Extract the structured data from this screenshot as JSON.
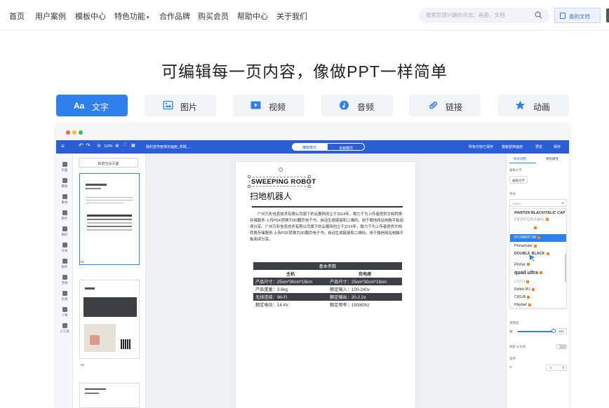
{
  "nav": {
    "items": [
      "首页",
      "用户案例",
      "模板中心",
      "特色功能",
      "合作品牌",
      "购买会员",
      "帮助中心",
      "关于我们"
    ],
    "search_placeholder": "搜索您感兴趣的杂志、画册、文档",
    "my_docs": "我的文档"
  },
  "hero": {
    "title": "可编辑每一页内容，像做PPT一样简单"
  },
  "feature_tabs": [
    {
      "label": "文字",
      "icon": "text-aa-icon",
      "active": true,
      "prefix": "Aa"
    },
    {
      "label": "图片",
      "icon": "image-icon",
      "active": false
    },
    {
      "label": "视频",
      "icon": "video-icon",
      "active": false
    },
    {
      "label": "音频",
      "icon": "audio-icon",
      "active": false
    },
    {
      "label": "链接",
      "icon": "link-icon",
      "active": false
    },
    {
      "label": "动画",
      "icon": "star-icon",
      "active": false
    }
  ],
  "editor": {
    "zoom": "116%",
    "doc_name": "我的宣传册演示画册_草稿_...",
    "mode_edit": "编辑模式",
    "mode_preview": "全貌模式",
    "save_status": "所有内容已保存",
    "top_actions": [
      "模板替换画册",
      "预览",
      "保存"
    ],
    "rail": [
      "页面",
      "模板",
      "素材",
      "图片",
      "图形",
      "文本",
      "组件",
      "音频",
      "云盘",
      "人物",
      "小工具"
    ],
    "add_page": "新增空白页面",
    "thumb_labels": [
      "01",
      "02"
    ],
    "page": {
      "en_title": "SWEEPING ROBOT",
      "cn_title": "扫地机器人",
      "body": "广州万彩信息技术有限公司旗下的云展网创立于2014年，致力于为上传者提供文档转换存储服务-上传PDF转换为3D翻页电子书。自动生成链接和二维码，用于微信网站电脑平板阅读分享。广州万彩信息技术有限公司旗下的云展网创立于2014年。致力于为上传者提供文档转换存储服务-上传PDF转换为3D翻页电子书，自动生成链接和二维码。用于微信网站电脑平板阅读分享。",
      "table_title": "基本参数",
      "table_head": [
        "主机",
        "充电座"
      ],
      "rows": [
        [
          "产品尺寸：25cm*30cm*18cm",
          "产品尺寸：25cm*30cm*18cm"
        ],
        [
          "产品重量：3.8kg",
          "额定输入：100-240v"
        ],
        [
          "无线连接：Wi-Fi",
          "额定输出：20-2.2v"
        ],
        [
          "额定电压：14.4V",
          "额定频率：150/60hz"
        ]
      ]
    },
    "right_panel": {
      "tabs": [
        "样式调整",
        "物资属性"
      ],
      "section_text": "编辑文字",
      "edit_btn": "编辑文字",
      "font_label": "字体",
      "font_value": "Arimo",
      "fonts": [
        "PANTON BLACKITALIC CAP",
        "PERFORAMA",
        "",
        "HYJ1B00TJW",
        "Phosphate",
        "DOUBLE BLACK",
        "Prime",
        "quad ultra",
        "COCO",
        "Rafidz RU",
        "CNSJB",
        "Playball"
      ],
      "opacity_label": "透明度",
      "opacity_value": "100",
      "shadow_label": "阴影 & 投射",
      "rotate_label": "旋转",
      "rotate_value": "0"
    }
  },
  "colors": {
    "accent": "#2f80ed",
    "appbar": "#2b5ed6",
    "table_dark": "#3d3f44"
  }
}
